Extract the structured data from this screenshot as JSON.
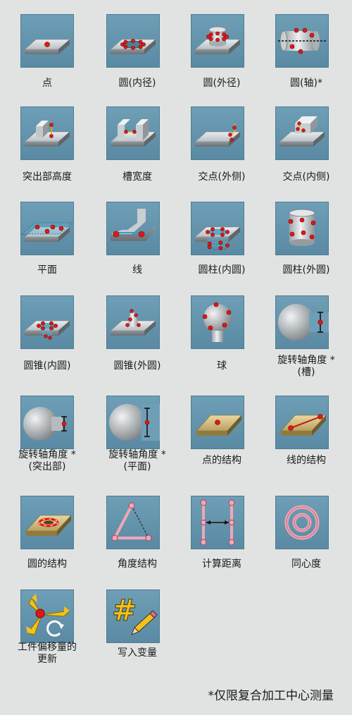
{
  "icons": [
    {
      "label_1": "点",
      "label_2": "",
      "icon": "point-on-plate-icon"
    },
    {
      "label_1": "圆(内径)",
      "label_2": "",
      "icon": "circle-inner-diameter-icon"
    },
    {
      "label_1": "圆(外径)",
      "label_2": "",
      "icon": "circle-outer-diameter-icon"
    },
    {
      "label_1": "圆(轴)*",
      "label_2": "",
      "icon": "circle-axis-icon"
    },
    {
      "label_1": "突出部高度",
      "label_2": "",
      "icon": "protrusion-height-icon"
    },
    {
      "label_1": "槽宽度",
      "label_2": "",
      "icon": "slot-width-icon"
    },
    {
      "label_1": "交点(外侧)",
      "label_2": "",
      "icon": "intersection-outer-icon"
    },
    {
      "label_1": "交点(内侧)",
      "label_2": "",
      "icon": "intersection-inner-icon"
    },
    {
      "label_1": "平面",
      "label_2": "",
      "icon": "plane-icon"
    },
    {
      "label_1": "线",
      "label_2": "",
      "icon": "line-icon"
    },
    {
      "label_1": "圆柱(内圆)",
      "label_2": "",
      "icon": "cylinder-inner-icon"
    },
    {
      "label_1": "圆柱(外圆)",
      "label_2": "",
      "icon": "cylinder-outer-icon"
    },
    {
      "label_1": "圆锥(内圆)",
      "label_2": "",
      "icon": "cone-inner-icon"
    },
    {
      "label_1": "圆锥(外圆)",
      "label_2": "",
      "icon": "cone-outer-icon"
    },
    {
      "label_1": "球",
      "label_2": "",
      "icon": "sphere-icon"
    },
    {
      "label_1": "旋转轴角度 *",
      "label_2": "(槽)",
      "icon": "rotary-axis-angle-slot-icon"
    },
    {
      "label_1": "旋转轴角度 *",
      "label_2": "(突出部)",
      "icon": "rotary-axis-angle-protrusion-icon"
    },
    {
      "label_1": "旋转轴角度 *",
      "label_2": "(平面)",
      "icon": "rotary-axis-angle-plane-icon"
    },
    {
      "label_1": "点的结构",
      "label_2": "",
      "icon": "point-construction-icon"
    },
    {
      "label_1": "线的结构",
      "label_2": "",
      "icon": "line-construction-icon"
    },
    {
      "label_1": "圆的结构",
      "label_2": "",
      "icon": "circle-construction-icon"
    },
    {
      "label_1": "角度结构",
      "label_2": "",
      "icon": "angle-construction-icon"
    },
    {
      "label_1": "计算距离",
      "label_2": "",
      "icon": "calculate-distance-icon"
    },
    {
      "label_1": "同心度",
      "label_2": "",
      "icon": "concentricity-icon"
    },
    {
      "label_1": "工件偏移量的",
      "label_2": "更新",
      "icon": "workpiece-offset-update-icon"
    },
    {
      "label_1": "写入变量",
      "label_2": "",
      "icon": "write-variable-icon"
    }
  ],
  "footnote": "*仅限复合加工中心测量"
}
